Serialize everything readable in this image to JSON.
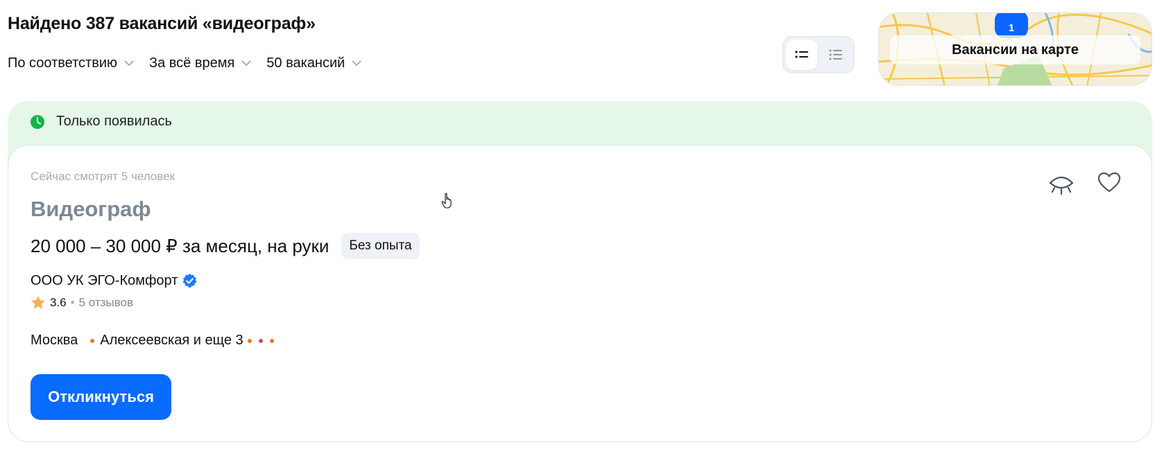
{
  "header": {
    "title": "Найдено 387 вакансий «видеограф»"
  },
  "filters": [
    {
      "label": "По соответствию"
    },
    {
      "label": "За всё время"
    },
    {
      "label": "50 вакансий"
    }
  ],
  "view_toggle": {
    "active": "list-compact"
  },
  "map": {
    "label": "Вакансии на карте",
    "pin_count": "1"
  },
  "banner": {
    "text": "Только появилась",
    "color": "#e4f7e8",
    "icon": "clock-icon"
  },
  "vacancy": {
    "watching": "Сейчас смотрят 5 человек",
    "title": "Видеограф",
    "salary": "20 000 – 30 000 ₽ за месяц, на руки",
    "experience": "Без опыта",
    "company": "ООО УК ЭГО-Комфорт",
    "rating": "3.6",
    "rating_sep": "•",
    "reviews": "5 отзывов",
    "city": "Москва",
    "metro": "Алексеевская и еще 3",
    "metro_colors": [
      "#e37b2c",
      "#e37b2c",
      "#d0466a",
      "#e37b2c"
    ],
    "apply_label": "Откликнуться"
  },
  "colors": {
    "accent": "#0a6bff",
    "verified": "#1f7bff",
    "star": "#f7b15b"
  }
}
